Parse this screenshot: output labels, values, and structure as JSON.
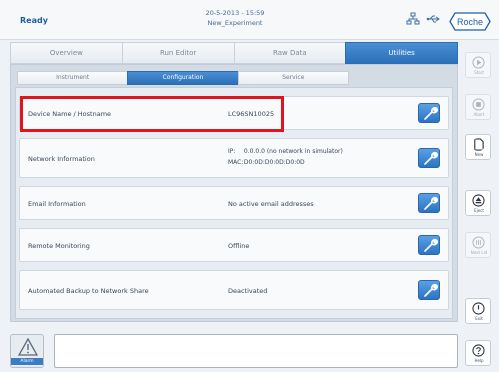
{
  "header": {
    "status": "Ready",
    "date_time": "20-5-2013 - 15:59",
    "experiment": "New_Experiment",
    "brand": "Roche"
  },
  "tabs": [
    {
      "label": "Overview",
      "active": false
    },
    {
      "label": "Run Editor",
      "active": false
    },
    {
      "label": "Raw Data",
      "active": false
    },
    {
      "label": "Utilities",
      "active": true
    }
  ],
  "subtabs": [
    {
      "label": "Instrument",
      "active": false
    },
    {
      "label": "Configuration",
      "active": true
    },
    {
      "label": "Service",
      "active": false
    }
  ],
  "rows": {
    "device": {
      "label": "Device Name / Hostname",
      "value": "LC96SN10025"
    },
    "network": {
      "label": "Network Information",
      "ip_key": "IP:",
      "ip_value": "0.0.0.0 (no network in simulator)",
      "mac_key": "MAC:",
      "mac_value": "D0:0D:D0:0D:D0:0D"
    },
    "email": {
      "label": "Email Information",
      "value": "No active email addresses"
    },
    "remote": {
      "label": "Remote Monitoring",
      "value": "Offline"
    },
    "backup": {
      "label": "Automated Backup to Network Share",
      "value": "Deactivated"
    }
  },
  "sidebar": {
    "start": "Start",
    "abort": "Abort",
    "new": "New",
    "eject": "Eject",
    "next_lid": "Next Lid",
    "exit": "Exit",
    "help": "Help"
  },
  "bottom": {
    "alarm": "Alarm"
  },
  "colors": {
    "accent": "#2b70b8",
    "highlight": "#e0141e"
  }
}
